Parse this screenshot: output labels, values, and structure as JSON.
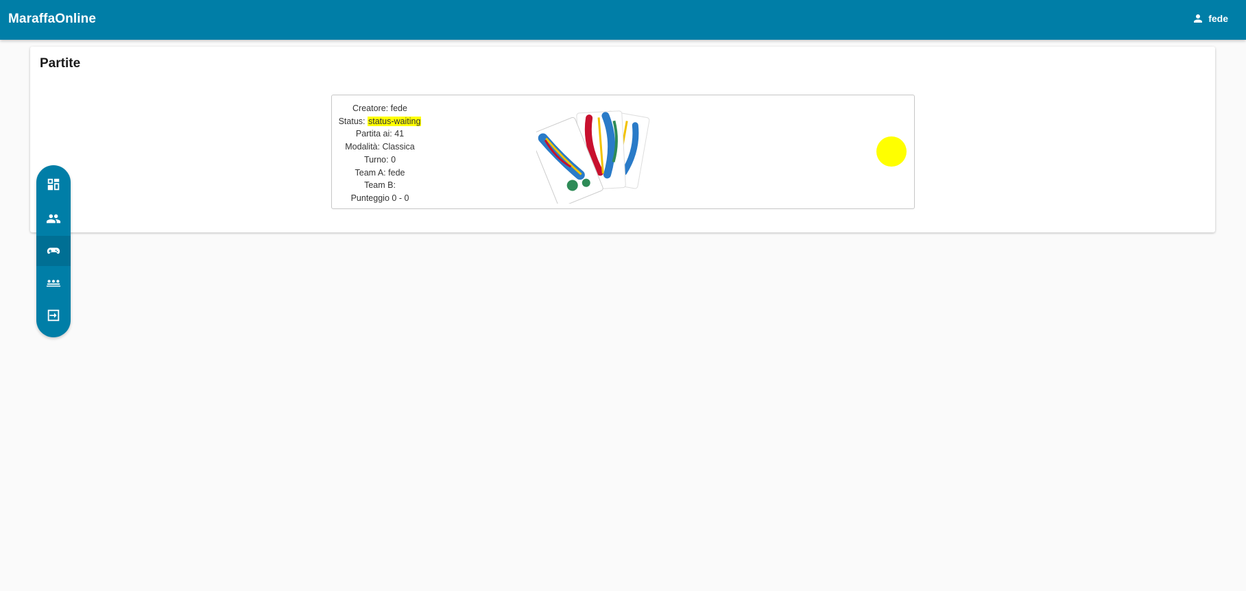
{
  "app": {
    "title": "MaraffaOnline"
  },
  "header": {
    "username": "fede",
    "user_icon": "account-icon"
  },
  "page": {
    "title": "Partite"
  },
  "game": {
    "creator_label": "Creatore:",
    "creator": "fede",
    "status_label": "Status:",
    "status": "status-waiting",
    "target_label": "Partita ai:",
    "target": "41",
    "mode_label": "Modalità:",
    "mode": "Classica",
    "turn_label": "Turno:",
    "turn": "0",
    "team_a_label": "Team A:",
    "team_a": "fede",
    "team_b_label": "Team B:",
    "team_b": "",
    "score_label": "Punteggio",
    "score": "0 - 0",
    "status_color": "#ffff00"
  },
  "sidebar": {
    "items": [
      {
        "icon": "dashboard-icon"
      },
      {
        "icon": "people-icon"
      },
      {
        "icon": "gamepad-icon"
      },
      {
        "icon": "groups-icon"
      },
      {
        "icon": "logout-icon"
      }
    ]
  },
  "colors": {
    "primary": "#007ea7",
    "background": "#fafafa",
    "status_waiting": "#ffff00"
  }
}
